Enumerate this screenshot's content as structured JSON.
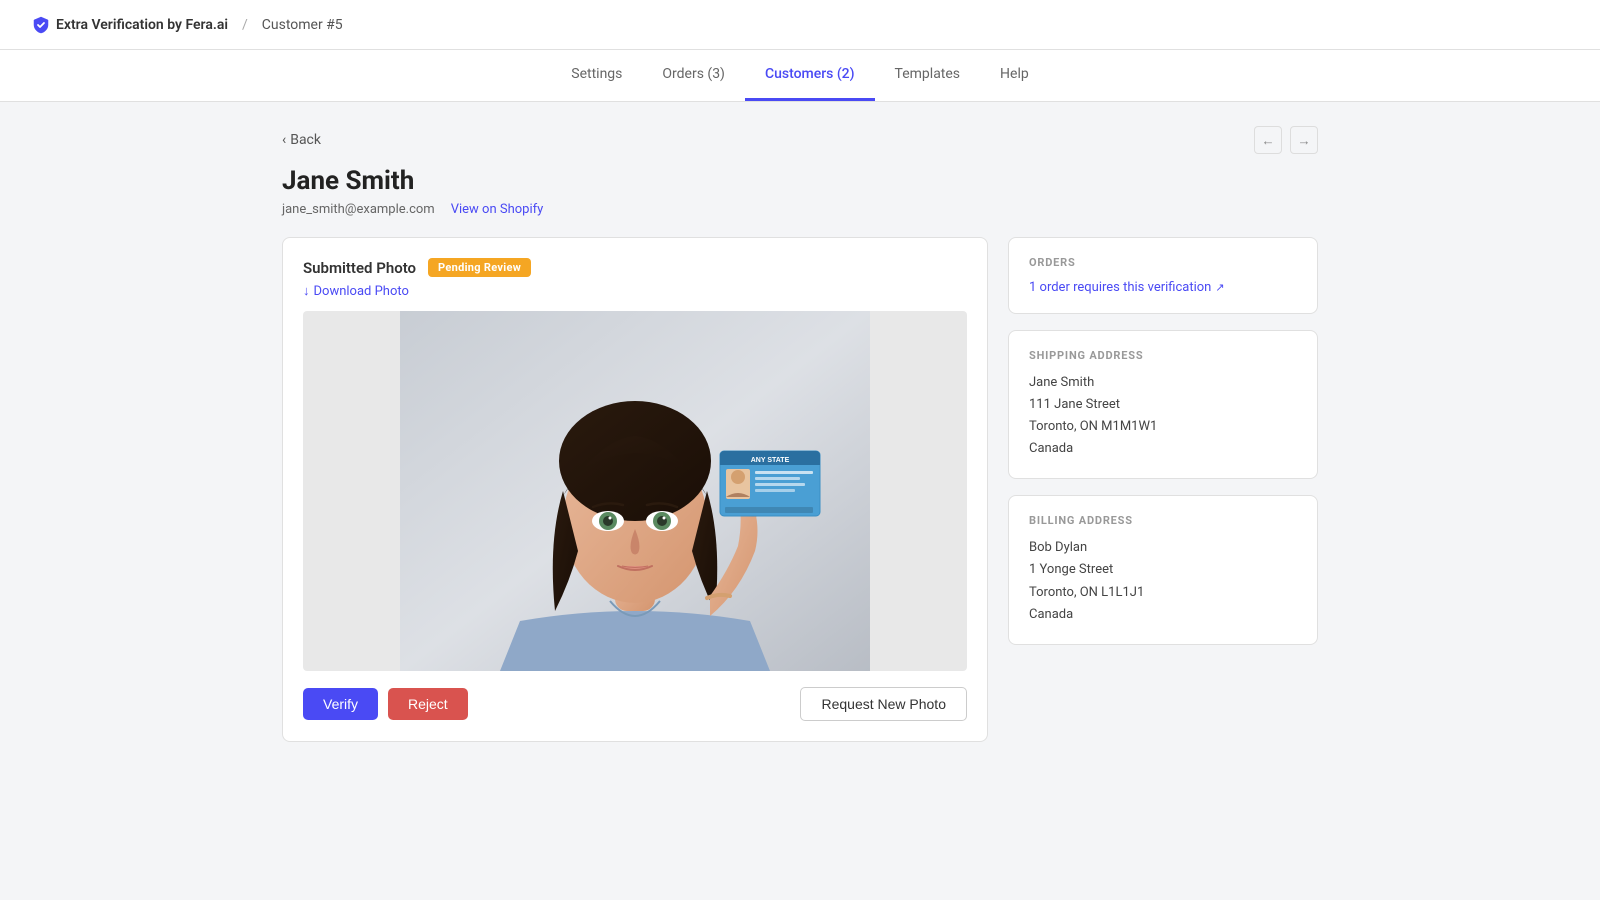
{
  "app": {
    "brand": "Extra Verification by Fera.ai",
    "separator": "/",
    "current_page": "Customer #5"
  },
  "nav": {
    "items": [
      {
        "label": "Settings",
        "id": "settings",
        "active": false
      },
      {
        "label": "Orders (3)",
        "id": "orders",
        "active": false
      },
      {
        "label": "Customers (2)",
        "id": "customers",
        "active": true
      },
      {
        "label": "Templates",
        "id": "templates",
        "active": false
      },
      {
        "label": "Help",
        "id": "help",
        "active": false
      }
    ]
  },
  "back_label": "Back",
  "customer": {
    "name": "Jane Smith",
    "email": "jane_smith@example.com",
    "view_shopify_label": "View on Shopify"
  },
  "photo_card": {
    "title": "Submitted Photo",
    "badge": "Pending Review",
    "download_label": "Download Photo",
    "verify_label": "Verify",
    "reject_label": "Reject",
    "request_label": "Request New Photo"
  },
  "orders_section": {
    "title": "ORDERS",
    "link_label": "1 order requires this verification"
  },
  "shipping": {
    "title": "SHIPPING ADDRESS",
    "name": "Jane Smith",
    "street": "111 Jane Street",
    "city_state": "Toronto, ON M1M1W1",
    "country": "Canada"
  },
  "billing": {
    "title": "BILLING ADDRESS",
    "name": "Bob Dylan",
    "street": "1 Yonge Street",
    "city_state": "Toronto, ON L1L1J1",
    "country": "Canada"
  },
  "colors": {
    "accent": "#4a4af4",
    "verify": "#4a4af4",
    "reject": "#d9534f",
    "badge": "#f5a623"
  }
}
